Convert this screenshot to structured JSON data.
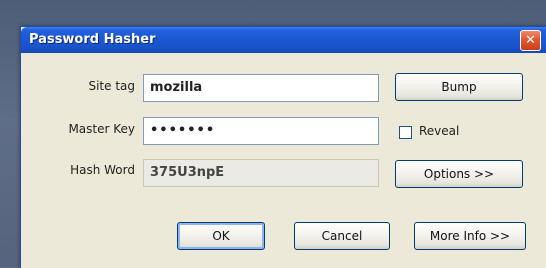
{
  "window": {
    "title": "Password Hasher",
    "close_label": "✕"
  },
  "form": {
    "site_tag_label": "Site tag",
    "site_tag_value": "mozilla",
    "master_key_label": "Master Key",
    "master_key_value": "•••••••",
    "hash_word_label": "Hash Word",
    "hash_word_value": "375U3npE"
  },
  "buttons": {
    "bump": "Bump",
    "reveal": "Reveal",
    "options": "Options >>",
    "ok": "OK",
    "cancel": "Cancel",
    "more_info": "More Info >>"
  },
  "reveal_checked": false
}
